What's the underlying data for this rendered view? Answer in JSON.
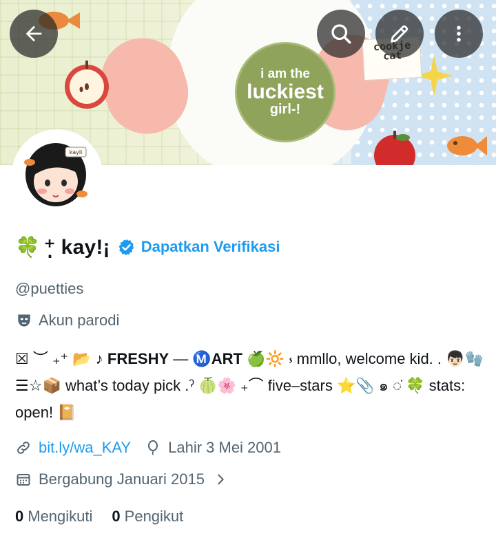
{
  "banner": {
    "badge_line1": "i am the",
    "badge_line2": "luckiest",
    "badge_line3": "girl-!",
    "note_text": "cookje cat",
    "avatar_tag": "kayli"
  },
  "toolbar": {
    "back_icon": "arrow-left-icon",
    "search_icon": "search-icon",
    "edit_icon": "pencil-icon",
    "more_icon": "more-vertical-icon"
  },
  "profile": {
    "name_prefix": "🍀",
    "display_name": "⁺̣ kay!¡",
    "verify_label": "Dapatkan Verifikasi",
    "handle": "@puetties",
    "parody_label": "Akun parodi"
  },
  "bio": {
    "seg1": "☒ ︶ ₊⁺ 📂 ♪ ",
    "brand1": "FRESHY",
    "seg2": " — Ⓜ️",
    "brand2": "ART",
    "seg3": " 🍏🔆 ⳽ mmllo, welcome kid. . 👦🏻🧤☰☆📦 what’s today pick .ˀ 🍈🌸 ₊⌒ five–stars ⭐📎 ๑ ◌̇ 🍀 stats: open! 📔"
  },
  "meta": {
    "link_text": "bit.ly/wa_KAY",
    "birth_text": "Lahir 3 Mei 2001",
    "joined_text": "Bergabung Januari 2015"
  },
  "follows": {
    "following_count": "0",
    "following_label": "Mengikuti",
    "followers_count": "0",
    "followers_label": "Pengikut"
  },
  "colors": {
    "accent": "#1d9bf0",
    "muted": "#536471",
    "text": "#0f1419"
  }
}
